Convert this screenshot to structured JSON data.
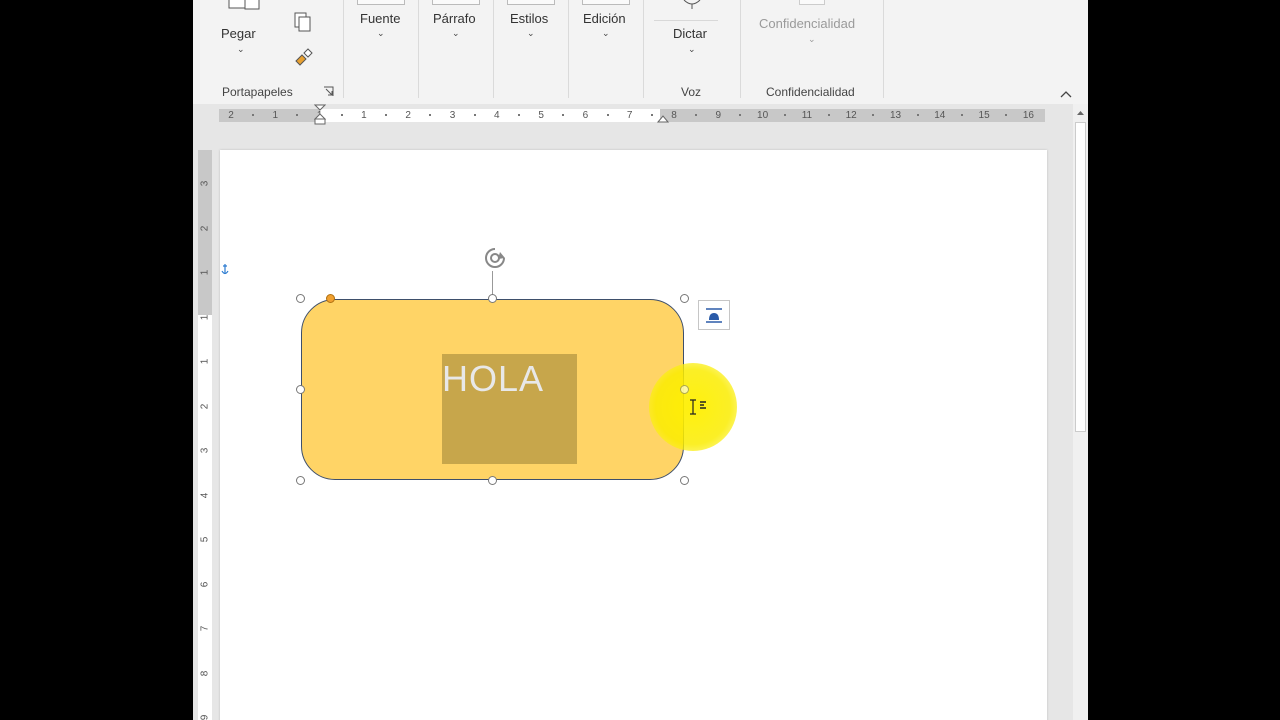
{
  "ribbon": {
    "clipboard": {
      "paste_label": "Pegar",
      "group_name": "Portapapeles"
    },
    "font_label": "Fuente",
    "paragraph_label": "Párrafo",
    "styles_label": "Estilos",
    "editing_label": "Edición",
    "voice": {
      "dictate_label": "Dictar",
      "group_name": "Voz"
    },
    "sensitivity": {
      "button_label": "Confidencialidad",
      "group_name": "Confidencialidad"
    }
  },
  "ruler": {
    "horizontal_labels": [
      "2",
      "1",
      "1",
      "1",
      "2",
      "3",
      "4",
      "5",
      "6",
      "7",
      "8",
      "9",
      "10",
      "11",
      "12",
      "13",
      "14",
      "15",
      "16"
    ],
    "vertical_labels": [
      "3",
      "2",
      "1",
      "1",
      "1",
      "2",
      "3",
      "4",
      "5",
      "6",
      "7",
      "8",
      "9"
    ]
  },
  "document": {
    "shape_text": "HOLA"
  },
  "colors": {
    "shape_fill": "#ffd466",
    "inner_box": "#c7a64b",
    "cursor_highlight": "#f7ec00"
  }
}
